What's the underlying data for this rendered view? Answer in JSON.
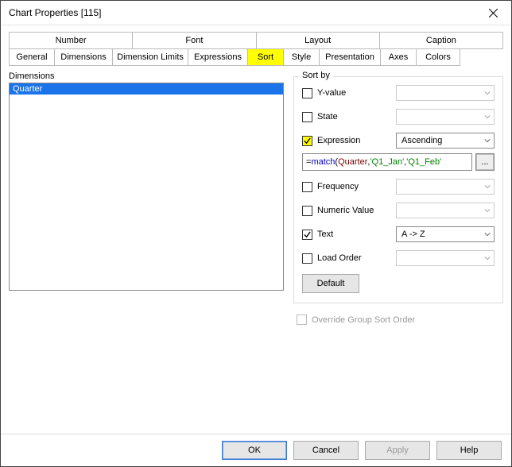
{
  "window": {
    "title": "Chart Properties [115]"
  },
  "tabs_upper": {
    "number": "Number",
    "font": "Font",
    "layout": "Layout",
    "caption": "Caption"
  },
  "tabs_lower": {
    "general": "General",
    "dimensions": "Dimensions",
    "dimension_limits": "Dimension Limits",
    "expressions": "Expressions",
    "sort": "Sort",
    "style": "Style",
    "presentation": "Presentation",
    "axes": "Axes",
    "colors": "Colors"
  },
  "left": {
    "label": "Dimensions",
    "items": [
      "Quarter"
    ]
  },
  "sortby": {
    "legend": "Sort by",
    "yvalue": {
      "label": "Y-value",
      "checked": false,
      "select": ""
    },
    "state": {
      "label": "State",
      "checked": false,
      "select": ""
    },
    "expression": {
      "label": "Expression",
      "checked": true,
      "highlight": true,
      "select": "Ascending",
      "expr_parts": {
        "eq": "=",
        "fn": "match",
        "open": "(",
        "field": "Quarter",
        "c1": ",",
        "s1": "'Q1_Jan'",
        "c2": ",",
        "s2": "'Q1_Feb'"
      },
      "more": "..."
    },
    "frequency": {
      "label": "Frequency",
      "checked": false,
      "select": ""
    },
    "numeric": {
      "label": "Numeric Value",
      "checked": false,
      "select": ""
    },
    "text": {
      "label": "Text",
      "checked": true,
      "select": "A -> Z"
    },
    "loadorder": {
      "label": "Load Order",
      "checked": false,
      "select": ""
    },
    "default_btn": "Default"
  },
  "override": {
    "label": "Override Group Sort Order"
  },
  "footer": {
    "ok": "OK",
    "cancel": "Cancel",
    "apply": "Apply",
    "help": "Help"
  }
}
